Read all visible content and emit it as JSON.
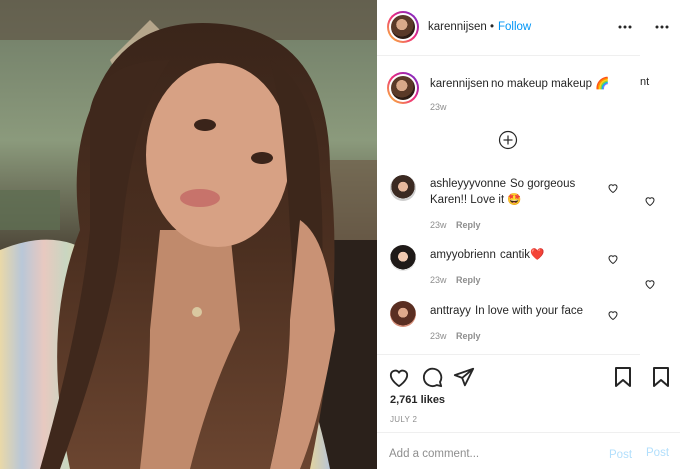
{
  "header": {
    "username": "karennijsen",
    "separator": "•",
    "follow_label": "Follow",
    "more_icon": "more-horizontal-icon"
  },
  "caption": {
    "username": "karennijsen",
    "text": "no makeup makeup 🌈",
    "time": "23w",
    "overflow_text": "nt"
  },
  "load_more_icon": "plus-circle-icon",
  "comments": [
    {
      "username": "ashleyyyvonne",
      "text_line1": "So gorgeous",
      "text_line2": "Karen!! Love it 🤩",
      "time": "23w",
      "reply_label": "Reply"
    },
    {
      "username": "amyyobrienn",
      "text_line1": "cantik❤️",
      "time": "23w",
      "reply_label": "Reply"
    },
    {
      "username": "anttrayy",
      "text_line1": "In love with your face",
      "time": "23w",
      "reply_label": "Reply"
    }
  ],
  "actions": {
    "like_icon": "heart-icon",
    "comment_icon": "comment-icon",
    "share_icon": "share-icon",
    "save_icon": "bookmark-icon"
  },
  "likes": "2,761 likes",
  "date": "JULY 2",
  "add_comment": {
    "placeholder": "Add a comment...",
    "post_label": "Post"
  },
  "colors": {
    "accent": "#0095f6",
    "post_disabled": "#b2dffc",
    "muted": "#8e8e8e",
    "text": "#262626"
  }
}
